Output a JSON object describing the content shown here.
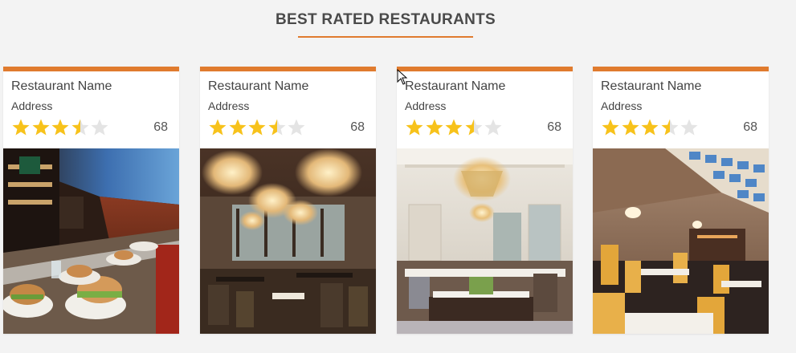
{
  "section": {
    "title": "BEST RATED RESTAURANTS",
    "accent_color": "#e07b2e"
  },
  "star_colors": {
    "filled": "#f7c21b",
    "empty": "#e4e4e4"
  },
  "cards": [
    {
      "name": "Restaurant Name",
      "address": "Address",
      "rating": 3.5,
      "max_rating": 5,
      "count": "68",
      "photo": "bar-counter-burgers-photo"
    },
    {
      "name": "Restaurant Name",
      "address": "Address",
      "rating": 3.5,
      "max_rating": 5,
      "count": "68",
      "photo": "chandelier-dining-hall-photo"
    },
    {
      "name": "Restaurant Name",
      "address": "Address",
      "rating": 3.5,
      "max_rating": 5,
      "count": "68",
      "photo": "ballroom-crystal-chandelier-photo"
    },
    {
      "name": "Restaurant Name",
      "address": "Address",
      "rating": 3.5,
      "max_rating": 5,
      "count": "68",
      "photo": "skylight-dining-room-photo"
    }
  ]
}
